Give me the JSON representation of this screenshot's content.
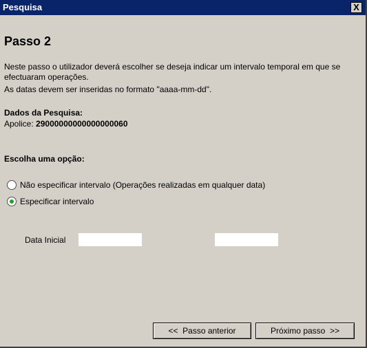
{
  "window": {
    "title": "Pesquisa",
    "close_label": "X"
  },
  "step": {
    "heading": "Passo 2",
    "instruction": "Neste passo o utilizador deverá escolher se deseja indicar um intervalo temporal em que se efectuaram operações.",
    "format_note": "As datas devem ser inseridas no formato \"aaaa-mm-dd\"."
  },
  "search_data": {
    "title": "Dados da Pesquisa:",
    "policy_label": "Apolice:",
    "policy_value": "29000000000000000060"
  },
  "options": {
    "title": "Escolha uma opção:",
    "items": [
      {
        "label": "Não especificar intervalo (Operações realizadas em qualquer data)",
        "checked": false
      },
      {
        "label": "Especificar intervalo",
        "checked": true
      }
    ]
  },
  "dates": {
    "start_label": "Data Inicial",
    "start_value": "",
    "end_value": ""
  },
  "buttons": {
    "prev_label": "<<  Passo anterior",
    "next_label": "Próximo passo  >>"
  },
  "colors": {
    "titlebar": "#0a246a",
    "window_bg": "#d4d0c8",
    "radio_dot": "#21a121"
  }
}
